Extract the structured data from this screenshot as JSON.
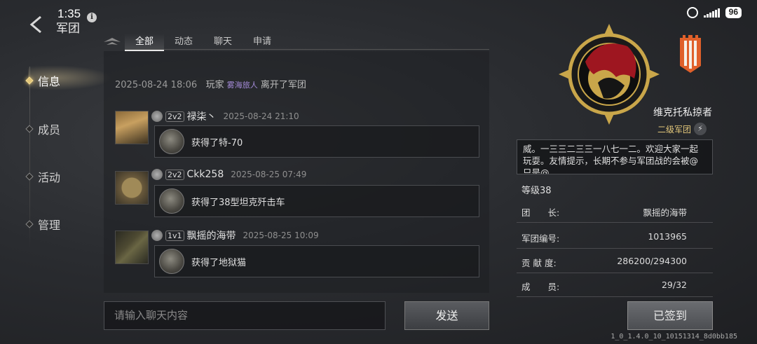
{
  "status_bar": {
    "time": "1:35",
    "battery": "96"
  },
  "header": {
    "title": "军团"
  },
  "nav": {
    "items": [
      {
        "label": "信息"
      },
      {
        "label": "成员"
      },
      {
        "label": "活动"
      },
      {
        "label": "管理"
      }
    ]
  },
  "tabs": [
    {
      "label": "全部"
    },
    {
      "label": "动态"
    },
    {
      "label": "聊天"
    },
    {
      "label": "申请"
    }
  ],
  "system_message": {
    "datetime": "2025-08-24  18:06",
    "prefix": "玩家",
    "player": "雾海旅人",
    "suffix": "离开了军团"
  },
  "messages": [
    {
      "mode": "2v2",
      "name": "禄柒丶",
      "time": "2025-08-24  21:10",
      "text": "获得了特-70"
    },
    {
      "mode": "2v2",
      "name": "Ckk258",
      "time": "2025-08-25  07:49",
      "text": "获得了38型坦克歼击车"
    },
    {
      "mode": "1v1",
      "name": "飘摇的海带",
      "time": "2025-08-25  10:09",
      "text": "获得了地狱猫"
    }
  ],
  "chat_input": {
    "placeholder": "请输入聊天内容"
  },
  "send_label": "发送",
  "legion": {
    "name": "维克托私掠者",
    "rank": "二级军团",
    "description": "威。一三三二三三一八七一二。欢迎大家一起玩耍。友情提示，长期不参与军团战的会被@只是@",
    "level": "等级38",
    "rows": [
      {
        "key": "团　　长:",
        "value": "飘摇的海带"
      },
      {
        "key": "军团编号:",
        "value": "1013965"
      },
      {
        "key": "贡 献 度:",
        "value": "286200/294300"
      },
      {
        "key": "成　　员:",
        "value": "29/32"
      }
    ],
    "signed_label": "已签到"
  },
  "version": "1_0_1.4.0_10_10151314_8d0bb185",
  "colors": {
    "accent_gold": "#e3c77a",
    "player_name": "#a48bd8",
    "banner_orange": "#e0602a"
  }
}
